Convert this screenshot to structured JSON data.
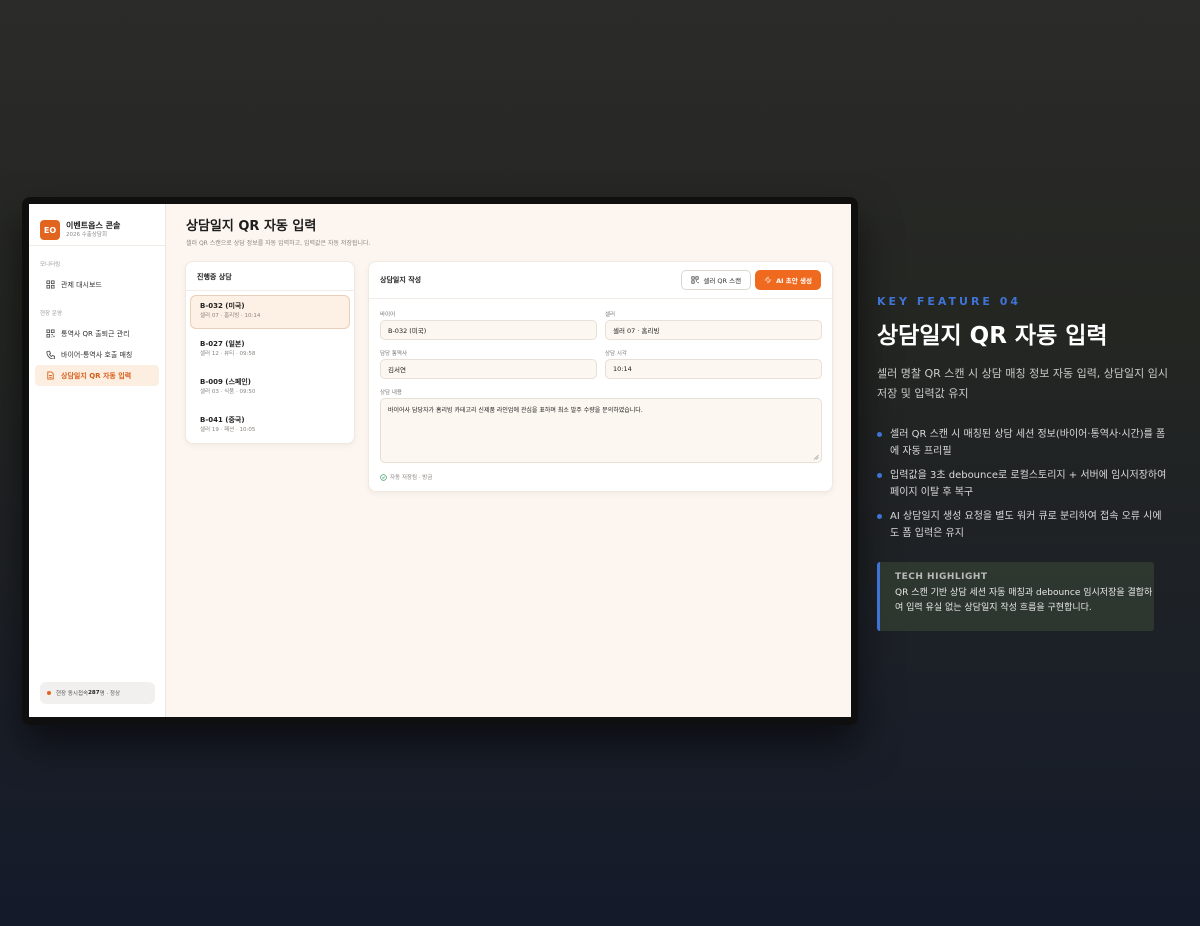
{
  "brand": {
    "logo": "EO",
    "name": "이벤트옵스 콘솔",
    "sub": "2026 수출상담회"
  },
  "sidebar": {
    "section_monitoring": "모니터링",
    "dashboard": "관제 대시보드",
    "section_ops": "현장 운영",
    "items": [
      {
        "label": "통역사 QR 출퇴근 관리",
        "icon": "qr-icon"
      },
      {
        "label": "바이어-통역사 호출 매칭",
        "icon": "phone-icon"
      },
      {
        "label": "상담일지 QR 자동 입력",
        "icon": "document-icon"
      }
    ],
    "status_prefix": "현장 동시접속 ",
    "status_count": "287",
    "status_suffix": "명 · 정상"
  },
  "page": {
    "title": "상담일지 QR 자동 입력",
    "desc": "셀러 QR 스캔으로 상담 정보를 자동 입력하고, 입력값은 자동 저장됩니다."
  },
  "sessions": {
    "title": "진행중 상담",
    "items": [
      {
        "title": "B-032 (미국)",
        "sub": "셀러 07 · 홈리빙 · 10:14"
      },
      {
        "title": "B-027 (일본)",
        "sub": "셀러 12 · 뷰티 · 09:58"
      },
      {
        "title": "B-009 (스페인)",
        "sub": "셀러 03 · 식품 · 09:50"
      },
      {
        "title": "B-041 (중국)",
        "sub": "셀러 19 · 패션 · 10:05"
      }
    ]
  },
  "log": {
    "title": "상담일지 작성",
    "scan_btn": "셀러 QR 스캔",
    "ai_btn": "AI 초안 생성",
    "buyer_label": "바이어",
    "buyer_value": "B-032 (미국)",
    "seller_label": "셀러",
    "seller_value": "셀러 07 · 홈리빙",
    "interpreter_label": "담당 통역사",
    "interpreter_value": "김서연",
    "time_label": "상담 시각",
    "time_value": "10:14",
    "content_label": "상담 내용",
    "content_value": "바이어사 담당자가 홈리빙 카테고리 신제품 라인업에 관심을 표하며 최소 발주 수량을 문의하였습니다.",
    "autosave": "자동 저장됨 · 방금"
  },
  "feature": {
    "tag": "KEY FEATURE 04",
    "title": "상담일지 QR 자동 입력",
    "desc": "셀러 명찰 QR 스캔 시 상담 매칭 정보 자동 입력, 상담일지 임시저장 및 입력값 유지",
    "bullets": [
      "셀러 QR 스캔 시 매칭된 상담 세션 정보(바이어·통역사·시간)를 폼에 자동 프리필",
      "입력값을 3초 debounce로 로컬스토리지 + 서버에 임시저장하여 페이지 이탈 후 복구",
      "AI 상담일지 생성 요청을 별도 워커 큐로 분리하여 접속 오류 시에도 폼 입력은 유지"
    ],
    "tech_title": "TECH HIGHLIGHT",
    "tech_text": "QR 스캔 기반 상담 세션 자동 매칭과 debounce 임시저장을 결합하여 입력 유실 없는 상담일지 작성 흐름을 구현합니다."
  },
  "colors": {
    "accent": "#ef6a1f",
    "blue": "#3f73d6"
  }
}
